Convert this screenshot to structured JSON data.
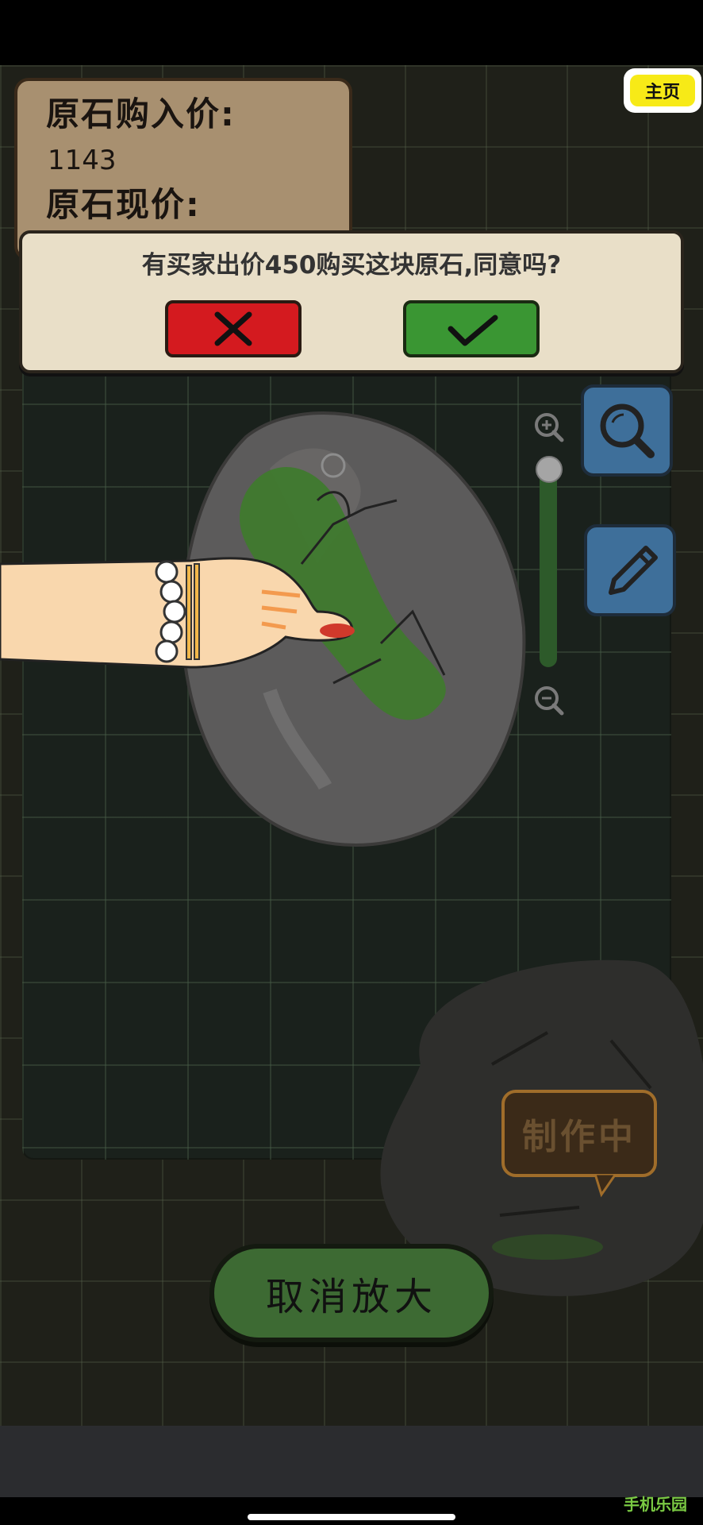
{
  "price_card": {
    "purchase_label": "原石购入价:",
    "purchase_value": "1143",
    "current_label": "原石现价:"
  },
  "home_button": {
    "label": "主页"
  },
  "dialog": {
    "message": "有买家出价450购买这块原石,同意吗?",
    "reject_icon": "close-icon",
    "accept_icon": "check-icon"
  },
  "tools": {
    "magnifier_icon": "magnifier-icon",
    "pencil_icon": "pencil-icon",
    "zoom_in_icon": "zoom-in-icon",
    "zoom_out_icon": "zoom-out-icon",
    "zoom_level": 1.0
  },
  "status_badge": {
    "label": "制作中"
  },
  "cancel_button": {
    "label": "取消放大"
  },
  "watermark": {
    "label": "手机乐园"
  },
  "colors": {
    "accept": "#3a9633",
    "reject": "#d41a1f",
    "home_yellow": "#f7ea17",
    "tool_blue": "#3e6f9a",
    "jade_green": "#3f7a2e"
  }
}
